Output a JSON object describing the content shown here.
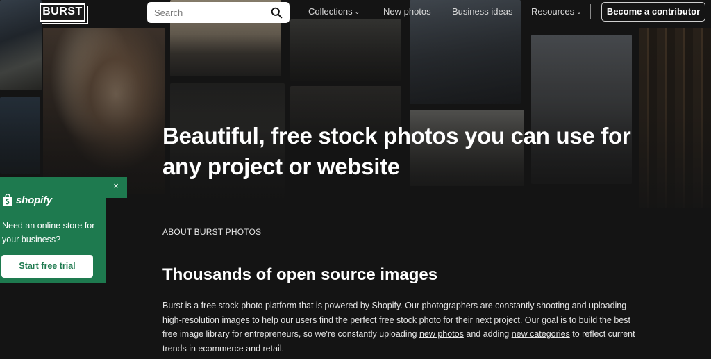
{
  "header": {
    "logo_text": "BURST",
    "search": {
      "placeholder": "Search"
    },
    "nav": [
      {
        "label": "Collections",
        "has_dropdown": true
      },
      {
        "label": "New photos",
        "has_dropdown": false
      },
      {
        "label": "Business ideas",
        "has_dropdown": false
      },
      {
        "label": "Resources",
        "has_dropdown": true
      }
    ],
    "contribute_label": "Become a contributor",
    "chevron": "⌄"
  },
  "hero": {
    "title": "Beautiful, free stock photos you can use for any project or website"
  },
  "about": {
    "label": "ABOUT BURST PHOTOS",
    "heading": "Thousands of open source images",
    "body_start": "Burst is a free stock photo platform that is powered by Shopify. Our photographers are constantly shooting and uploading high-resolution images to help our users find the perfect free stock photo for their next project. Our goal is to build the best free image library for entrepreneurs, so we're constantly uploading ",
    "link_new_photos": "new photos",
    "body_mid": " and adding ",
    "link_new_categories": "new categories",
    "body_end": " to reflect current trends in ecommerce and retail."
  },
  "promo": {
    "brand": "shopify",
    "close_symbol": "×",
    "text": "Need an online store for your business?",
    "cta_label": "Start free trial",
    "color": "#1e7a4f"
  },
  "icons": {
    "search": "search-icon",
    "close": "close-icon",
    "chevron": "chevron-down-icon",
    "shopify": "shopify-bag-icon"
  }
}
